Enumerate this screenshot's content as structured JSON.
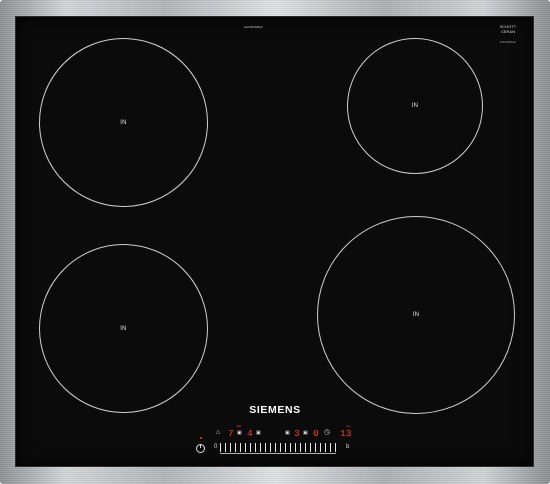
{
  "hob": {
    "brand": "SIEMENS",
    "model_code": "EH645FEB1E",
    "glass_maker_line1": "SCHOTT",
    "glass_maker_line2": "CERAN",
    "glass_maker_sub": "EH645FEB1E",
    "zones": [
      {
        "id": "rear-left",
        "label": "IN"
      },
      {
        "id": "rear-right",
        "label": "IN"
      },
      {
        "id": "front-left",
        "label": "IN"
      },
      {
        "id": "front-right",
        "label": "IN"
      }
    ],
    "control_panel": {
      "display_1": "7",
      "display_2": "4",
      "display_3": "3",
      "display_4": "0",
      "timer_display": "13",
      "min_label": "0",
      "max_label": "b",
      "timer_indicator": "min",
      "small_red_label": "400"
    },
    "colors": {
      "glass": "#0b0b0b",
      "zone_outline": "#cfcfcf",
      "display_red": "#ff3b2e",
      "frame": "#b3b7ba"
    },
    "icons": [
      "power-icon",
      "lock-icon",
      "timer-icon",
      "boost-icon"
    ]
  }
}
